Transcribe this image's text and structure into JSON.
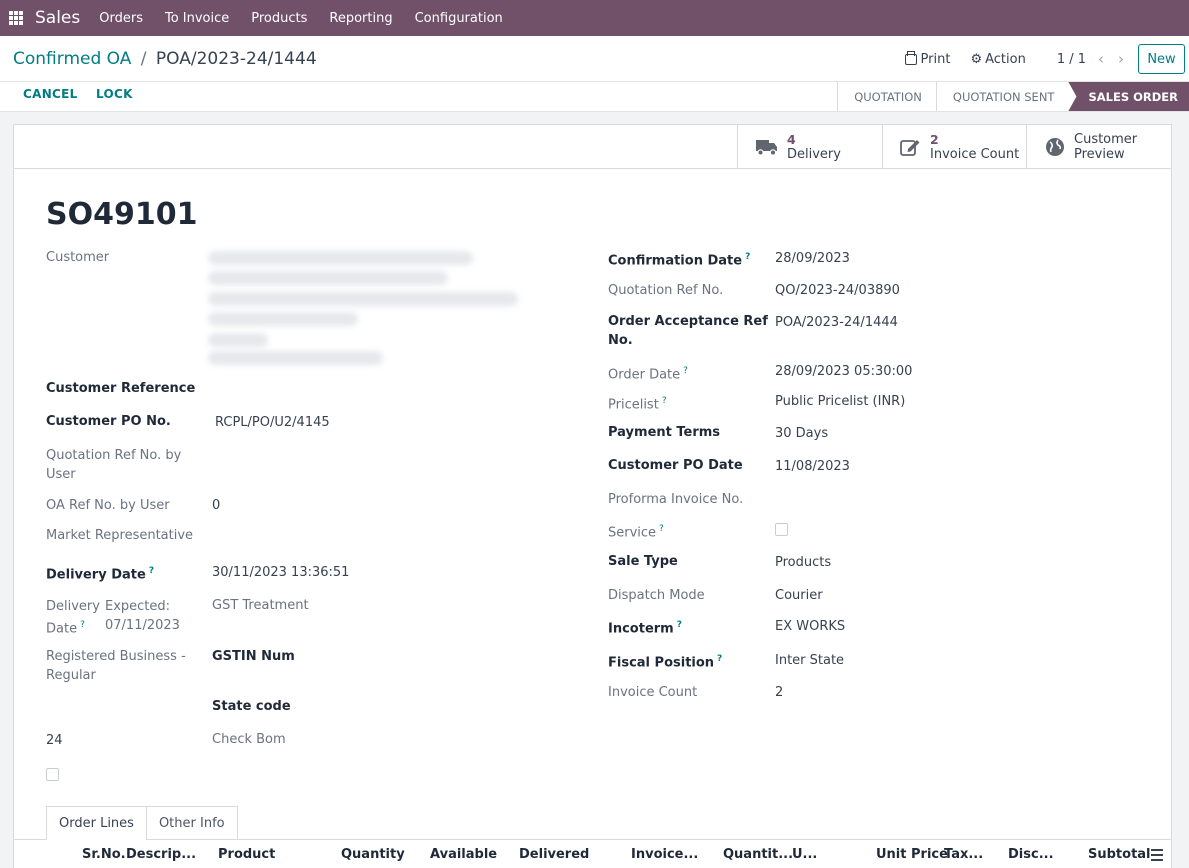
{
  "navbar": {
    "brand": "Sales",
    "menu": [
      "Orders",
      "To Invoice",
      "Products",
      "Reporting",
      "Configuration"
    ]
  },
  "breadcrumb": {
    "parent": "Confirmed OA",
    "separator": "/",
    "current": "POA/2023-24/1444"
  },
  "controls": {
    "print_label": "Print",
    "action_label": "Action",
    "pager": "1 / 1",
    "prev_icon": "chevron-left-icon",
    "next_icon": "chevron-right-icon",
    "new_label": "New"
  },
  "statusbar": {
    "cancel_label": "CANCEL",
    "lock_label": "LOCK",
    "stages": [
      "QUOTATION",
      "QUOTATION SENT",
      "SALES ORDER"
    ],
    "active_stage": "SALES ORDER"
  },
  "smart_buttons": {
    "delivery": {
      "value": "4",
      "label": "Delivery",
      "icon": "truck-icon"
    },
    "invoice": {
      "value": "2",
      "label": "Invoice Count",
      "icon": "edit-icon"
    },
    "preview": {
      "line1": "Customer",
      "line2": "Preview",
      "icon": "globe-icon"
    }
  },
  "form": {
    "title": "SO49101",
    "left": {
      "customer_label": "Customer",
      "customer_reference_label": "Customer Reference",
      "customer_po_label": "Customer PO No.",
      "customer_po_value": "RCPL/PO/U2/4145",
      "quotation_ref_user_label": "Quotation Ref No. by User",
      "oa_ref_user_label": "OA Ref No. by User",
      "oa_ref_user_value": "0",
      "market_rep_label": "Market Representative",
      "delivery_date_label": "Delivery Date",
      "delivery_date_value": "30/11/2023 13:36:51",
      "delivery_date2_label_1": "Delivery",
      "delivery_date2_label_2": "Date",
      "expected_label": "Expected:",
      "expected_value": "07/11/2023",
      "gst_treatment_label": "GST Treatment",
      "registered_business_1": "Registered Business -",
      "registered_business_2": "Regular",
      "gstin_label": "GSTIN Num",
      "state_code_label": "State code",
      "state_code_value": "24",
      "check_bom_label": "Check Bom"
    },
    "right": {
      "confirmation_date_label": "Confirmation Date",
      "confirmation_date_value": "28/09/2023",
      "quotation_ref_label": "Quotation Ref No.",
      "quotation_ref_value": "QO/2023-24/03890",
      "order_acceptance_label_1": "Order Acceptance Ref",
      "order_acceptance_label_2": "No.",
      "order_acceptance_value": "POA/2023-24/1444",
      "order_date_label": "Order Date",
      "order_date_value": "28/09/2023 05:30:00",
      "pricelist_label": "Pricelist",
      "pricelist_value": "Public Pricelist (INR)",
      "payment_terms_label": "Payment Terms",
      "payment_terms_value": "30 Days",
      "customer_po_date_label": "Customer PO Date",
      "customer_po_date_value": "11/08/2023",
      "proforma_label": "Proforma Invoice No.",
      "service_label": "Service",
      "sale_type_label": "Sale Type",
      "sale_type_value": "Products",
      "dispatch_mode_label": "Dispatch Mode",
      "dispatch_mode_value": "Courier",
      "incoterm_label": "Incoterm",
      "incoterm_value": "EX WORKS",
      "fiscal_position_label": "Fiscal Position",
      "fiscal_position_value": "Inter State",
      "invoice_count_label": "Invoice Count",
      "invoice_count_value": "2"
    },
    "help_mark": "?"
  },
  "tabs": [
    "Order Lines",
    "Other Info"
  ],
  "order_lines_columns": [
    "Sr.No.",
    "Descrip...",
    "Product",
    "Quantity",
    "Available",
    "Delivered",
    "Invoice...",
    "Quantit...",
    "U...",
    "Unit Price",
    "Tax...",
    "Disc...",
    "Subtotal"
  ],
  "colors": {
    "navbar": "#71516a",
    "accent": "#017e84",
    "active_stage": "#71516a"
  }
}
